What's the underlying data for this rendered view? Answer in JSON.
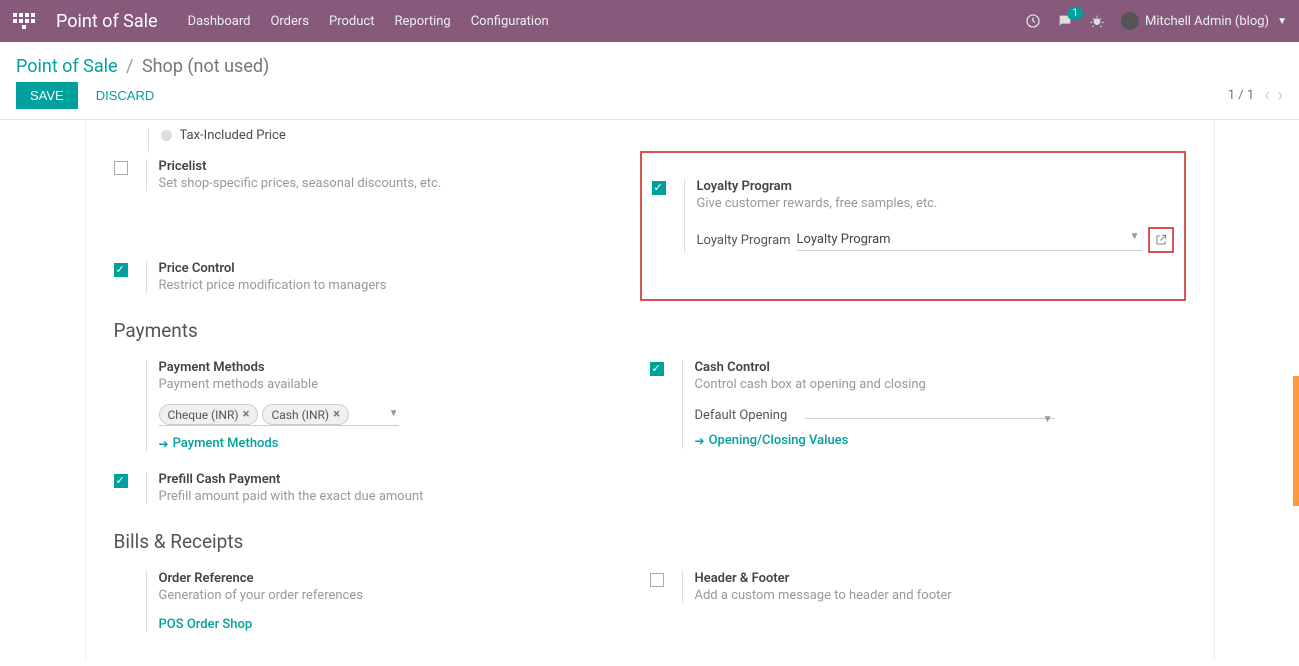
{
  "header": {
    "app_title": "Point of Sale",
    "nav": [
      "Dashboard",
      "Orders",
      "Product",
      "Reporting",
      "Configuration"
    ],
    "messages_badge": "1",
    "user": "Mitchell Admin (blog)"
  },
  "breadcrumb": {
    "root": "Point of Sale",
    "sep": "/",
    "leaf": "Shop (not used)"
  },
  "actions": {
    "save": "SAVE",
    "discard": "DISCARD"
  },
  "pager": {
    "text": "1 / 1"
  },
  "settings": {
    "tax_included": "Tax-Included Price",
    "pricelist": {
      "title": "Pricelist",
      "desc": "Set shop-specific prices, seasonal discounts, etc."
    },
    "price_control": {
      "title": "Price Control",
      "desc": "Restrict price modification to managers"
    },
    "loyalty": {
      "title": "Loyalty Program",
      "desc": "Give customer rewards, free samples, etc.",
      "field_label": "Loyalty Program",
      "field_value": "Loyalty Program"
    }
  },
  "sections": {
    "payments": "Payments",
    "bills": "Bills & Receipts"
  },
  "payments": {
    "pm": {
      "title": "Payment Methods",
      "desc": "Payment methods available",
      "tags": [
        "Cheque (INR)",
        "Cash (INR)"
      ],
      "link": "Payment Methods"
    },
    "cash": {
      "title": "Cash Control",
      "desc": "Control cash box at opening and closing",
      "default_label": "Default Opening",
      "link": "Opening/Closing Values"
    },
    "prefill": {
      "title": "Prefill Cash Payment",
      "desc": "Prefill amount paid with the exact due amount"
    }
  },
  "bills": {
    "order_ref": {
      "title": "Order Reference",
      "desc": "Generation of your order references",
      "link": "POS Order Shop"
    },
    "header_footer": {
      "title": "Header & Footer",
      "desc": "Add a custom message to header and footer"
    }
  }
}
